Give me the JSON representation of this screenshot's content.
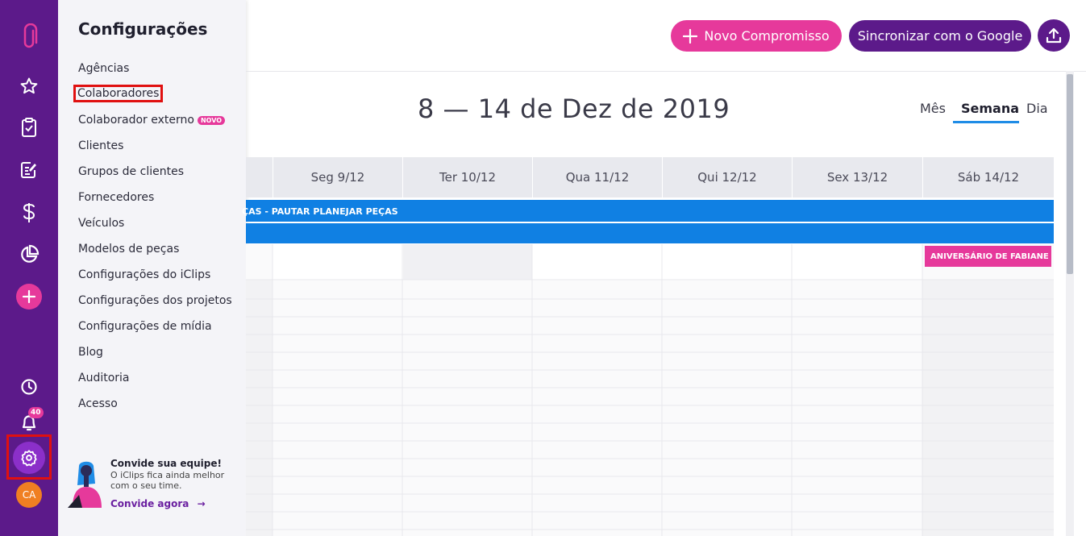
{
  "rail": {
    "icons": [
      "paperclip-logo-icon",
      "star-icon",
      "clipboard-check-icon",
      "edit-document-icon",
      "dollar-icon",
      "pie-chart-icon",
      "add-icon",
      "clock-icon",
      "bell-icon",
      "gear-icon"
    ],
    "notification_count": "40",
    "avatar_initials": "CA"
  },
  "panel": {
    "title": "Configurações",
    "items": [
      {
        "label": "Agências"
      },
      {
        "label": "Colaboradores"
      },
      {
        "label": "Colaborador externo",
        "badge": "NOVO"
      },
      {
        "label": "Clientes"
      },
      {
        "label": "Grupos de clientes"
      },
      {
        "label": "Fornecedores"
      },
      {
        "label": "Veículos"
      },
      {
        "label": "Modelos de peças"
      },
      {
        "label": "Configurações do iClips"
      },
      {
        "label": "Configurações dos projetos"
      },
      {
        "label": "Configurações de mídia"
      },
      {
        "label": "Blog"
      },
      {
        "label": "Auditoria"
      },
      {
        "label": "Acesso"
      }
    ],
    "invite": {
      "title": "Convide sua equipe!",
      "text": "O iClips fica ainda melhor com o seu time.",
      "link": "Convide agora"
    }
  },
  "header": {
    "new_button": "Novo Compromisso",
    "sync_button": "Sincronizar com o Google"
  },
  "calendar": {
    "date_range": "8 — 14 de Dez de 2019",
    "views": [
      "Mês",
      "Semana",
      "Dia"
    ],
    "active_view": "Semana",
    "days": [
      "Seg 9/12",
      "Ter 10/12",
      "Qua 11/12",
      "Qui 12/12",
      "Sex 13/12",
      "Sáb 14/12"
    ],
    "event_banner": "ÇAS - PAUTAR PLANEJAR PEÇAS",
    "birthday_event": "ANIVERSÁRIO DE FABIANE M"
  },
  "colors": {
    "rail": "#5c1a8a",
    "accent_pink": "#e6399b",
    "event_blue": "#1080e3",
    "highlight_red": "#e01010"
  }
}
